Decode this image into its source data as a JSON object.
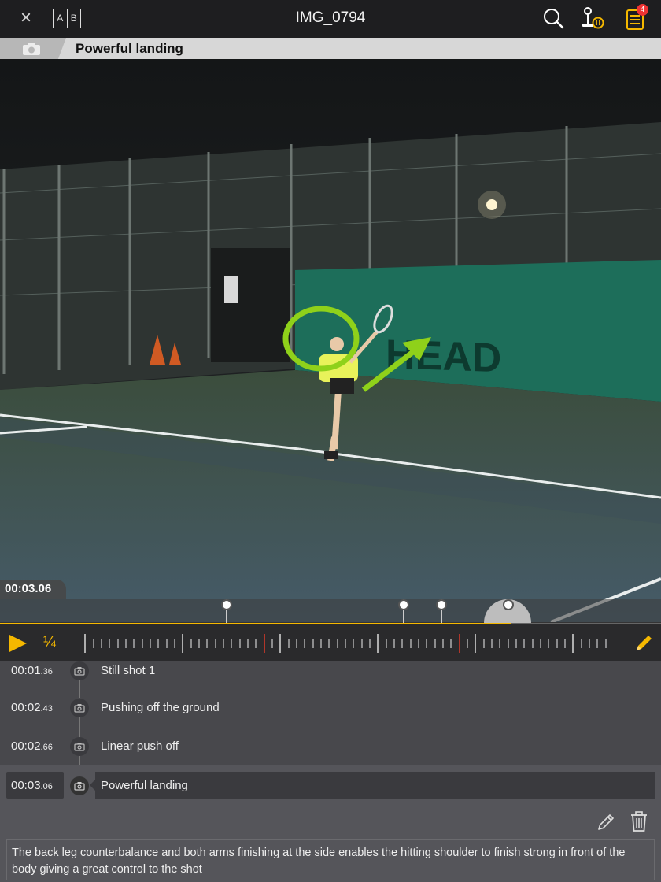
{
  "app": {
    "title": "IMG_0794",
    "ab_left": "A",
    "ab_right": "B",
    "close_glyph": "×",
    "notes_badge": "4"
  },
  "caption": {
    "text": "Powerful landing"
  },
  "video": {
    "timecode": "00:03.06",
    "annotation_color": "#8fd11a"
  },
  "timeline": {
    "progress": 0.774,
    "markers": [
      0.342,
      0.611,
      0.668,
      0.769
    ]
  },
  "controls": {
    "speed": "¼"
  },
  "notes": [
    {
      "time_main": "00:01",
      "time_frac": ".36",
      "label": "Still shot 1"
    },
    {
      "time_main": "00:02",
      "time_frac": ".43",
      "label": "Pushing off the ground"
    },
    {
      "time_main": "00:02",
      "time_frac": ".66",
      "label": "Linear push off"
    }
  ],
  "selected_note": {
    "time_main": "00:03",
    "time_frac": ".06",
    "label": "Powerful landing",
    "description": "The back leg counterbalance and both arms finishing at the side enables the hitting shoulder to finish strong in front of the body giving a great control to the shot"
  },
  "colors": {
    "accent": "#f5b800",
    "badge": "#e33333",
    "panel": "#48484c"
  }
}
